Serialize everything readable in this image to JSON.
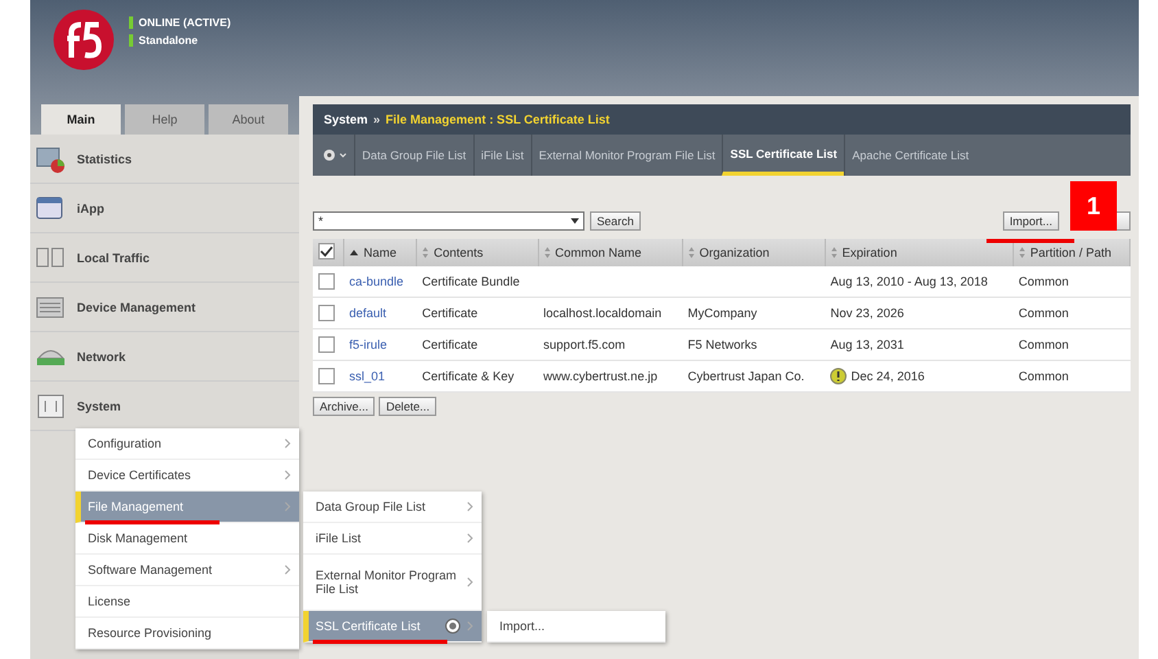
{
  "header": {
    "status": "ONLINE (ACTIVE)",
    "mode": "Standalone"
  },
  "main_tabs": [
    {
      "label": "Main",
      "selected": true
    },
    {
      "label": "Help",
      "selected": false
    },
    {
      "label": "About",
      "selected": false
    }
  ],
  "sidebar": {
    "items": [
      {
        "label": "Statistics",
        "kind": "stats"
      },
      {
        "label": "iApp",
        "kind": "app"
      },
      {
        "label": "Local Traffic",
        "kind": "traffic"
      },
      {
        "label": "Device Management",
        "kind": "device"
      },
      {
        "label": "Network",
        "kind": "network"
      },
      {
        "label": "System",
        "kind": "system"
      }
    ]
  },
  "breadcrumb": {
    "root": "System",
    "sep": "»",
    "path": "File Management : SSL Certificate List"
  },
  "sub_tabs": [
    {
      "label": "Data Group File List",
      "selected": false
    },
    {
      "label": "iFile List",
      "selected": false
    },
    {
      "label": "External Monitor Program File List",
      "selected": false
    },
    {
      "label": "SSL Certificate List",
      "selected": true
    },
    {
      "label": "Apache Certificate List",
      "selected": false
    }
  ],
  "search": {
    "value": "*",
    "button": "Search"
  },
  "import_button": "Import...",
  "annotation_badge": "1",
  "table": {
    "all_checked": true,
    "columns": [
      "Name",
      "Contents",
      "Common Name",
      "Organization",
      "Expiration",
      "Partition / Path"
    ],
    "rows": [
      {
        "checked": false,
        "name": "ca-bundle",
        "contents": "Certificate Bundle",
        "common_name": "",
        "organization": "",
        "expiration": "Aug 13, 2010 - Aug 13, 2018",
        "warning": false,
        "partition": "Common"
      },
      {
        "checked": false,
        "name": "default",
        "contents": "Certificate",
        "common_name": "localhost.localdomain",
        "organization": "MyCompany",
        "expiration": "Nov 23, 2026",
        "warning": false,
        "partition": "Common"
      },
      {
        "checked": false,
        "name": "f5-irule",
        "contents": "Certificate",
        "common_name": "support.f5.com",
        "organization": "F5 Networks",
        "expiration": "Aug 13, 2031",
        "warning": false,
        "partition": "Common"
      },
      {
        "checked": false,
        "name": "ssl_01",
        "contents": "Certificate & Key",
        "common_name": "www.cybertrust.ne.jp",
        "organization": "Cybertrust Japan Co.",
        "expiration": "Dec 24, 2016",
        "warning": true,
        "partition": "Common"
      }
    ]
  },
  "table_buttons": [
    "Archive...",
    "Delete..."
  ],
  "system_menu": [
    {
      "label": "Configuration",
      "has_submenu": true,
      "selected": false,
      "underlined": false
    },
    {
      "label": "Device Certificates",
      "has_submenu": true,
      "selected": false,
      "underlined": false
    },
    {
      "label": "File Management",
      "has_submenu": true,
      "selected": true,
      "underlined": true
    },
    {
      "label": "Disk Management",
      "has_submenu": false,
      "selected": false,
      "underlined": false
    },
    {
      "label": "Software Management",
      "has_submenu": true,
      "selected": false,
      "underlined": false
    },
    {
      "label": "License",
      "has_submenu": false,
      "selected": false,
      "underlined": false
    },
    {
      "label": "Resource Provisioning",
      "has_submenu": false,
      "selected": false,
      "underlined": false
    }
  ],
  "file_menu": [
    {
      "label": "Data Group File List",
      "has_submenu": true,
      "selected": false,
      "underlined": false
    },
    {
      "label": "iFile List",
      "has_submenu": true,
      "selected": false,
      "underlined": false
    },
    {
      "label": "External Monitor Program File List",
      "has_submenu": true,
      "selected": false,
      "underlined": false
    },
    {
      "label": "SSL Certificate List",
      "has_submenu": true,
      "selected": true,
      "underlined": true
    }
  ],
  "ssl_menu": [
    {
      "label": "Import..."
    }
  ]
}
